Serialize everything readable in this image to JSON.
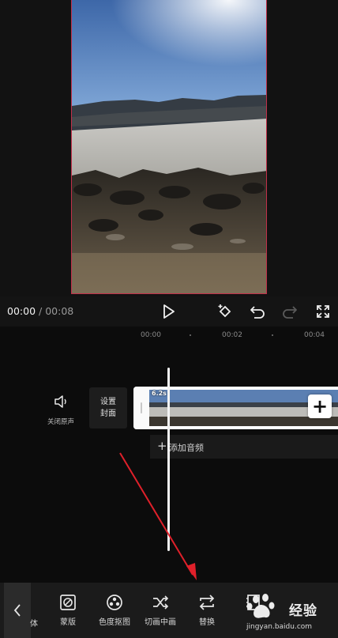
{
  "player": {
    "current_time": "00:00",
    "separator": " / ",
    "total_time": "00:08"
  },
  "ruler": {
    "ticks": [
      "00:00",
      "00:02",
      "00:04"
    ]
  },
  "track": {
    "mute_label": "关闭原声",
    "cover_line1": "设置",
    "cover_line2": "封面",
    "clip_duration": "6.2s",
    "add_audio_label": "添加音频"
  },
  "toolbar": {
    "partial_label": "体",
    "items": [
      {
        "label": "蒙版",
        "icon": "mask-icon"
      },
      {
        "label": "色度抠图",
        "icon": "chroma-key-icon"
      },
      {
        "label": "切画中画",
        "icon": "pip-switch-icon"
      },
      {
        "label": "替换",
        "icon": "replace-icon"
      }
    ]
  },
  "watermark": {
    "text": "经验",
    "url": "jingyan.baidu.com"
  },
  "colors": {
    "frame_border": "#c2304a",
    "annotation_arrow": "#e0202a",
    "background": "#111111"
  }
}
